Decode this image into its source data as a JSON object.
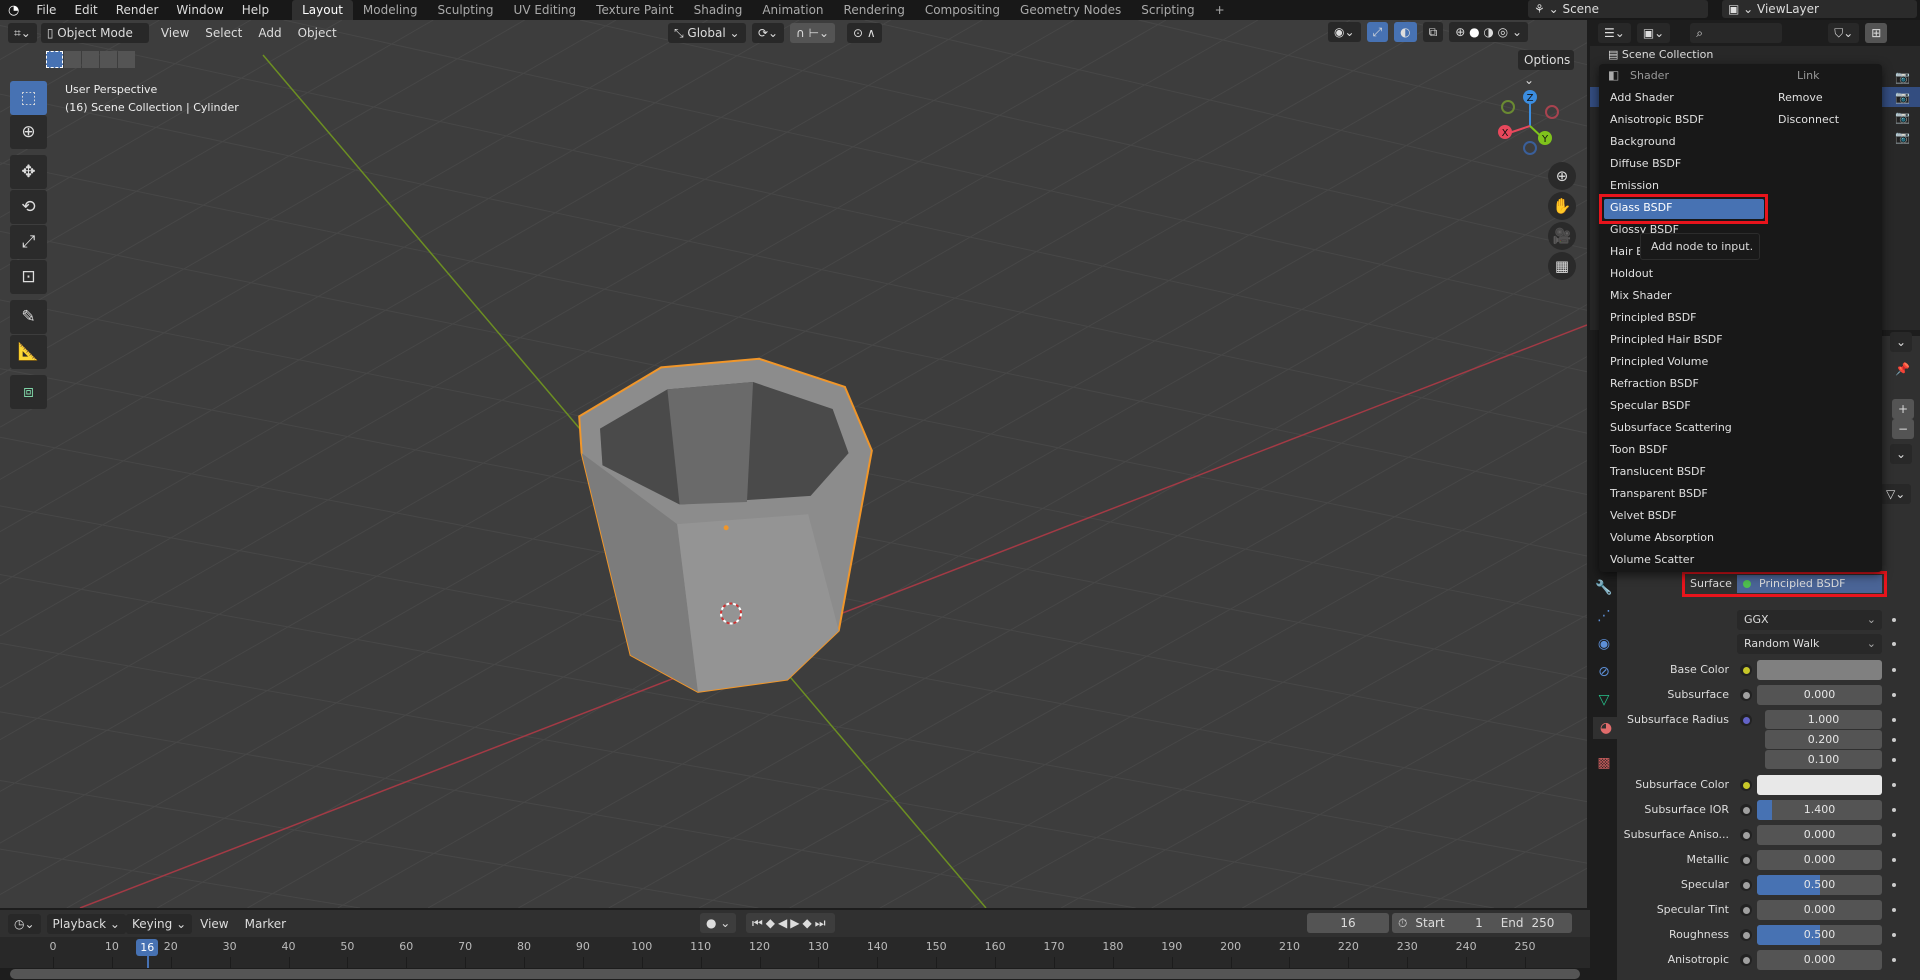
{
  "topbar": {
    "menus": [
      "File",
      "Edit",
      "Render",
      "Window",
      "Help"
    ],
    "workspaces": [
      "Layout",
      "Modeling",
      "Sculpting",
      "UV Editing",
      "Texture Paint",
      "Shading",
      "Animation",
      "Rendering",
      "Compositing",
      "Geometry Nodes",
      "Scripting"
    ],
    "active_workspace": "Layout",
    "add_workspace": "+",
    "scene": "Scene",
    "view_layer": "ViewLayer"
  },
  "viewport": {
    "mode": "Object Mode",
    "menus": [
      "View",
      "Select",
      "Add",
      "Object"
    ],
    "orientation": "Global",
    "options": "Options",
    "overlay_line1": "User Perspective",
    "overlay_line2": "(16) Scene Collection | Cylinder",
    "gizmo": {
      "x": "X",
      "y": "Y",
      "z": "Z"
    },
    "colors": {
      "x_axis": "#e8485c",
      "y_axis": "#7fc31c",
      "z_axis": "#3b8de0",
      "selection": "#f0962a"
    }
  },
  "outliner": {
    "root": "Scene Collection"
  },
  "context_menu": {
    "header_left": "Shader",
    "header_right": "Link",
    "shader_items": [
      "Add Shader",
      "Anisotropic BSDF",
      "Background",
      "Diffuse BSDF",
      "Emission",
      "Glass BSDF",
      "Glossy BSDF",
      "Hair BSDF",
      "Holdout",
      "Mix Shader",
      "Principled BSDF",
      "Principled Hair BSDF",
      "Principled Volume",
      "Refraction BSDF",
      "Specular BSDF",
      "Subsurface Scattering",
      "Toon BSDF",
      "Translucent BSDF",
      "Transparent BSDF",
      "Velvet BSDF",
      "Volume Absorption",
      "Volume Scatter"
    ],
    "link_items": [
      "Remove",
      "Disconnect"
    ],
    "highlighted": "Glass BSDF",
    "tooltip": "Add node to input."
  },
  "material": {
    "surface_label": "Surface",
    "surface_value": "Principled BSDF",
    "distribution": "GGX",
    "subsurface_method": "Random Walk",
    "props": [
      {
        "label": "Base Color",
        "type": "color",
        "color": "#808080",
        "socket": "#c7c729"
      },
      {
        "label": "Subsurface",
        "value": "0.000",
        "fraction": 0
      },
      {
        "label": "Subsurface Radius",
        "values": [
          "1.000",
          "0.200",
          "0.100"
        ],
        "socket": "#6363c7"
      },
      {
        "label": "Subsurface Color",
        "type": "color",
        "color": "#e8e8e8",
        "socket": "#c7c729"
      },
      {
        "label": "Subsurface IOR",
        "value": "1.400",
        "fraction": 0.12
      },
      {
        "label": "Subsurface Aniso...",
        "value": "0.000",
        "fraction": 0
      },
      {
        "label": "Metallic",
        "value": "0.000",
        "fraction": 0
      },
      {
        "label": "Specular",
        "value": "0.500",
        "fraction": 0.5
      },
      {
        "label": "Specular Tint",
        "value": "0.000",
        "fraction": 0
      },
      {
        "label": "Roughness",
        "value": "0.500",
        "fraction": 0.5
      },
      {
        "label": "Anisotropic",
        "value": "0.000",
        "fraction": 0
      }
    ]
  },
  "timeline": {
    "menus": [
      "Playback",
      "Keying",
      "View",
      "Marker"
    ],
    "current_frame": "16",
    "start_label": "Start",
    "start": "1",
    "end_label": "End",
    "end": "250",
    "ticks": [
      "0",
      "10",
      "20",
      "30",
      "40",
      "50",
      "60",
      "70",
      "80",
      "90",
      "100",
      "110",
      "120",
      "130",
      "140",
      "150",
      "160",
      "170",
      "180",
      "190",
      "200",
      "210",
      "220",
      "230",
      "240",
      "250"
    ]
  }
}
